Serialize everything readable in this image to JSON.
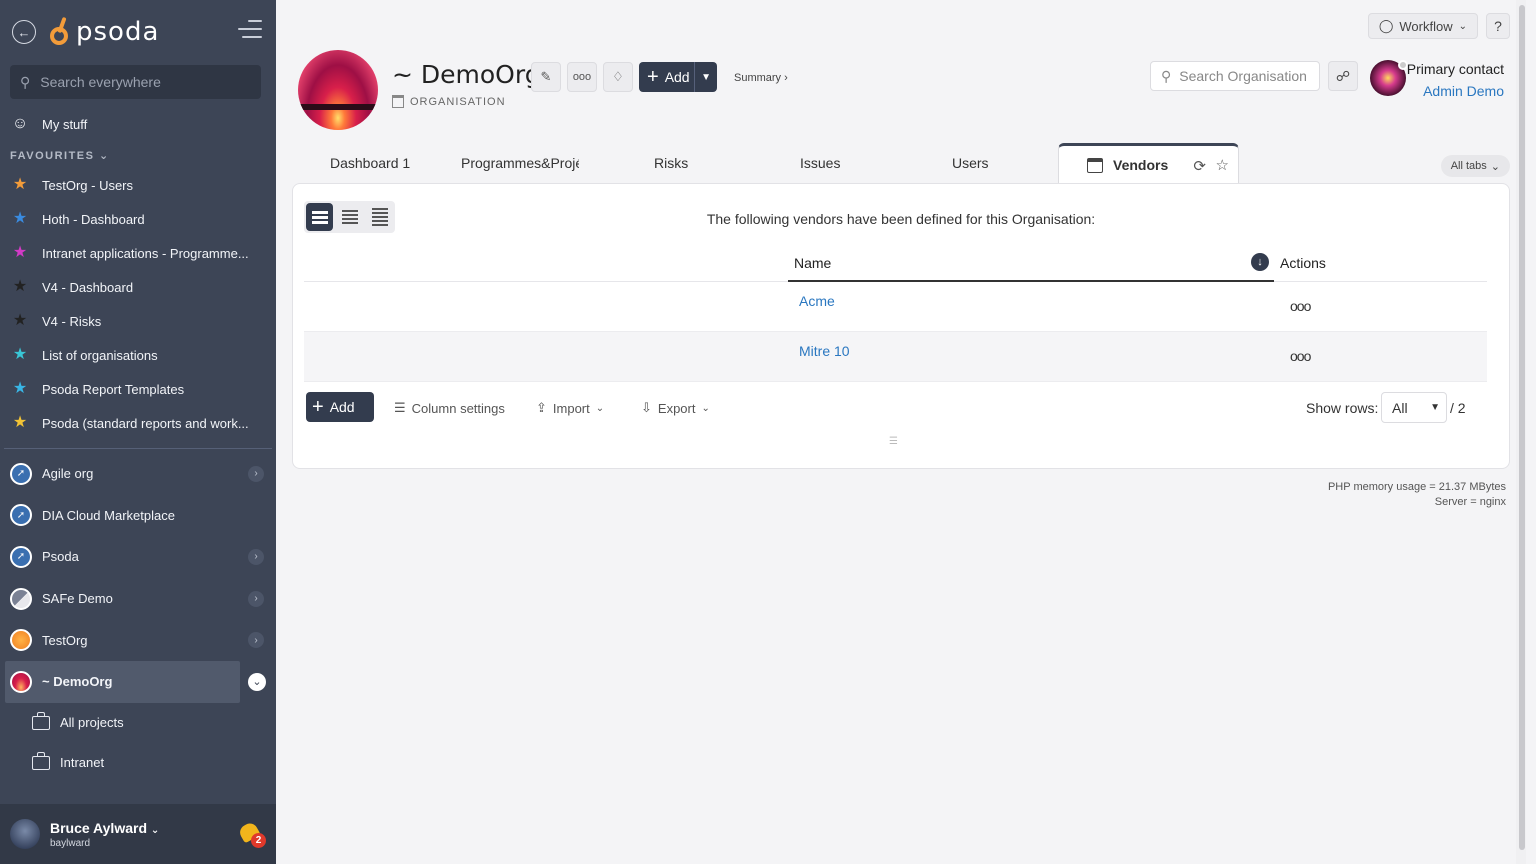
{
  "sidebar": {
    "logo_text": "psoda",
    "search_placeholder": "Search everywhere",
    "my_stuff": "My stuff",
    "favourites_heading": "FAVOURITES",
    "favourites": [
      {
        "label": "TestOrg - Users",
        "color": "#f39c3a"
      },
      {
        "label": "Hoth - Dashboard",
        "color": "#3a8be0"
      },
      {
        "label": "Intranet applications - Programme...",
        "color": "#d23ac6"
      },
      {
        "label": "V4 - Dashboard",
        "color": "#222222"
      },
      {
        "label": "V4 - Risks",
        "color": "#222222"
      },
      {
        "label": "List of organisations",
        "color": "#39c6d6"
      },
      {
        "label": "Psoda Report Templates",
        "color": "#39b6e6"
      },
      {
        "label": "Psoda (standard reports and work...",
        "color": "#f2c335"
      }
    ],
    "orgs": [
      {
        "label": "Agile org",
        "has_chevron": true
      },
      {
        "label": "DIA Cloud Marketplace",
        "has_chevron": false
      },
      {
        "label": "Psoda",
        "has_chevron": true
      },
      {
        "label": "SAFe Demo",
        "has_chevron": true
      },
      {
        "label": "TestOrg",
        "has_chevron": true
      },
      {
        "label": "~ DemoOrg",
        "has_chevron": true
      }
    ],
    "sub_items": [
      "All projects",
      "Intranet"
    ],
    "user": {
      "name": "Bruce Aylward",
      "login": "baylward",
      "notifications": "2"
    }
  },
  "header": {
    "org_name": "~ DemoOrg",
    "org_type": "ORGANISATION",
    "add_label": "Add",
    "summary_label": "Summary ›",
    "workflow_label": "Workflow",
    "help_label": "?",
    "search_placeholder": "Search Organisation",
    "primary_contact_label": "Primary contact",
    "primary_contact_name": "Admin Demo"
  },
  "tabs": {
    "items": [
      "Dashboard 1",
      "Programmes&Projé",
      "Risks",
      "Issues",
      "Users"
    ],
    "active": "Vendors",
    "all_tabs": "All tabs"
  },
  "table": {
    "intro": "The following vendors have been defined for this Organisation:",
    "col_name": "Name",
    "col_actions": "Actions",
    "rows": [
      {
        "name": "Acme",
        "actions": "ooo"
      },
      {
        "name": "Mitre 10",
        "actions": "ooo"
      }
    ],
    "add_label": "Add",
    "column_settings": "Column settings",
    "import_label": "Import",
    "export_label": "Export",
    "show_rows_label": "Show rows:",
    "show_rows_value": "All",
    "total": "/ 2"
  },
  "footer": {
    "memory": "PHP memory usage = 21.37 MBytes",
    "server": "Server = nginx"
  }
}
